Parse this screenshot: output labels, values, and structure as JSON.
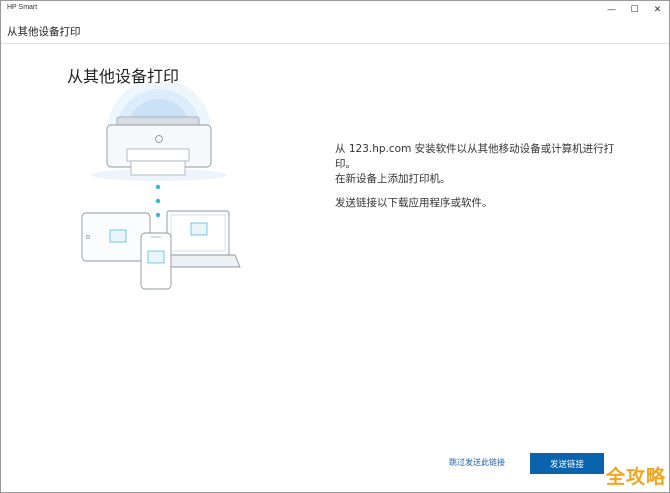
{
  "window": {
    "app_title": "HP Smart",
    "minimize": "—",
    "maximize": "☐",
    "close": "✕"
  },
  "header": {
    "title": "从其他设备打印"
  },
  "main": {
    "heading": "从其他设备打印",
    "description": [
      "从 123.hp.com 安装软件以从其他移动设备或计算机进行打印。",
      "在新设备上添加打印机。",
      "发送链接以下载应用程序或软件。"
    ]
  },
  "footer": {
    "skip_link": "跳过发送此链接",
    "send_button": "发送链接"
  },
  "watermark": "全攻略",
  "icons": [
    "printer-icon",
    "laptop-icon",
    "tablet-icon",
    "phone-icon"
  ],
  "colors": {
    "accent": "#0a64ad",
    "link": "#1a5fa8",
    "halo": "#dcecfa",
    "dots": "#3fb6d6"
  }
}
